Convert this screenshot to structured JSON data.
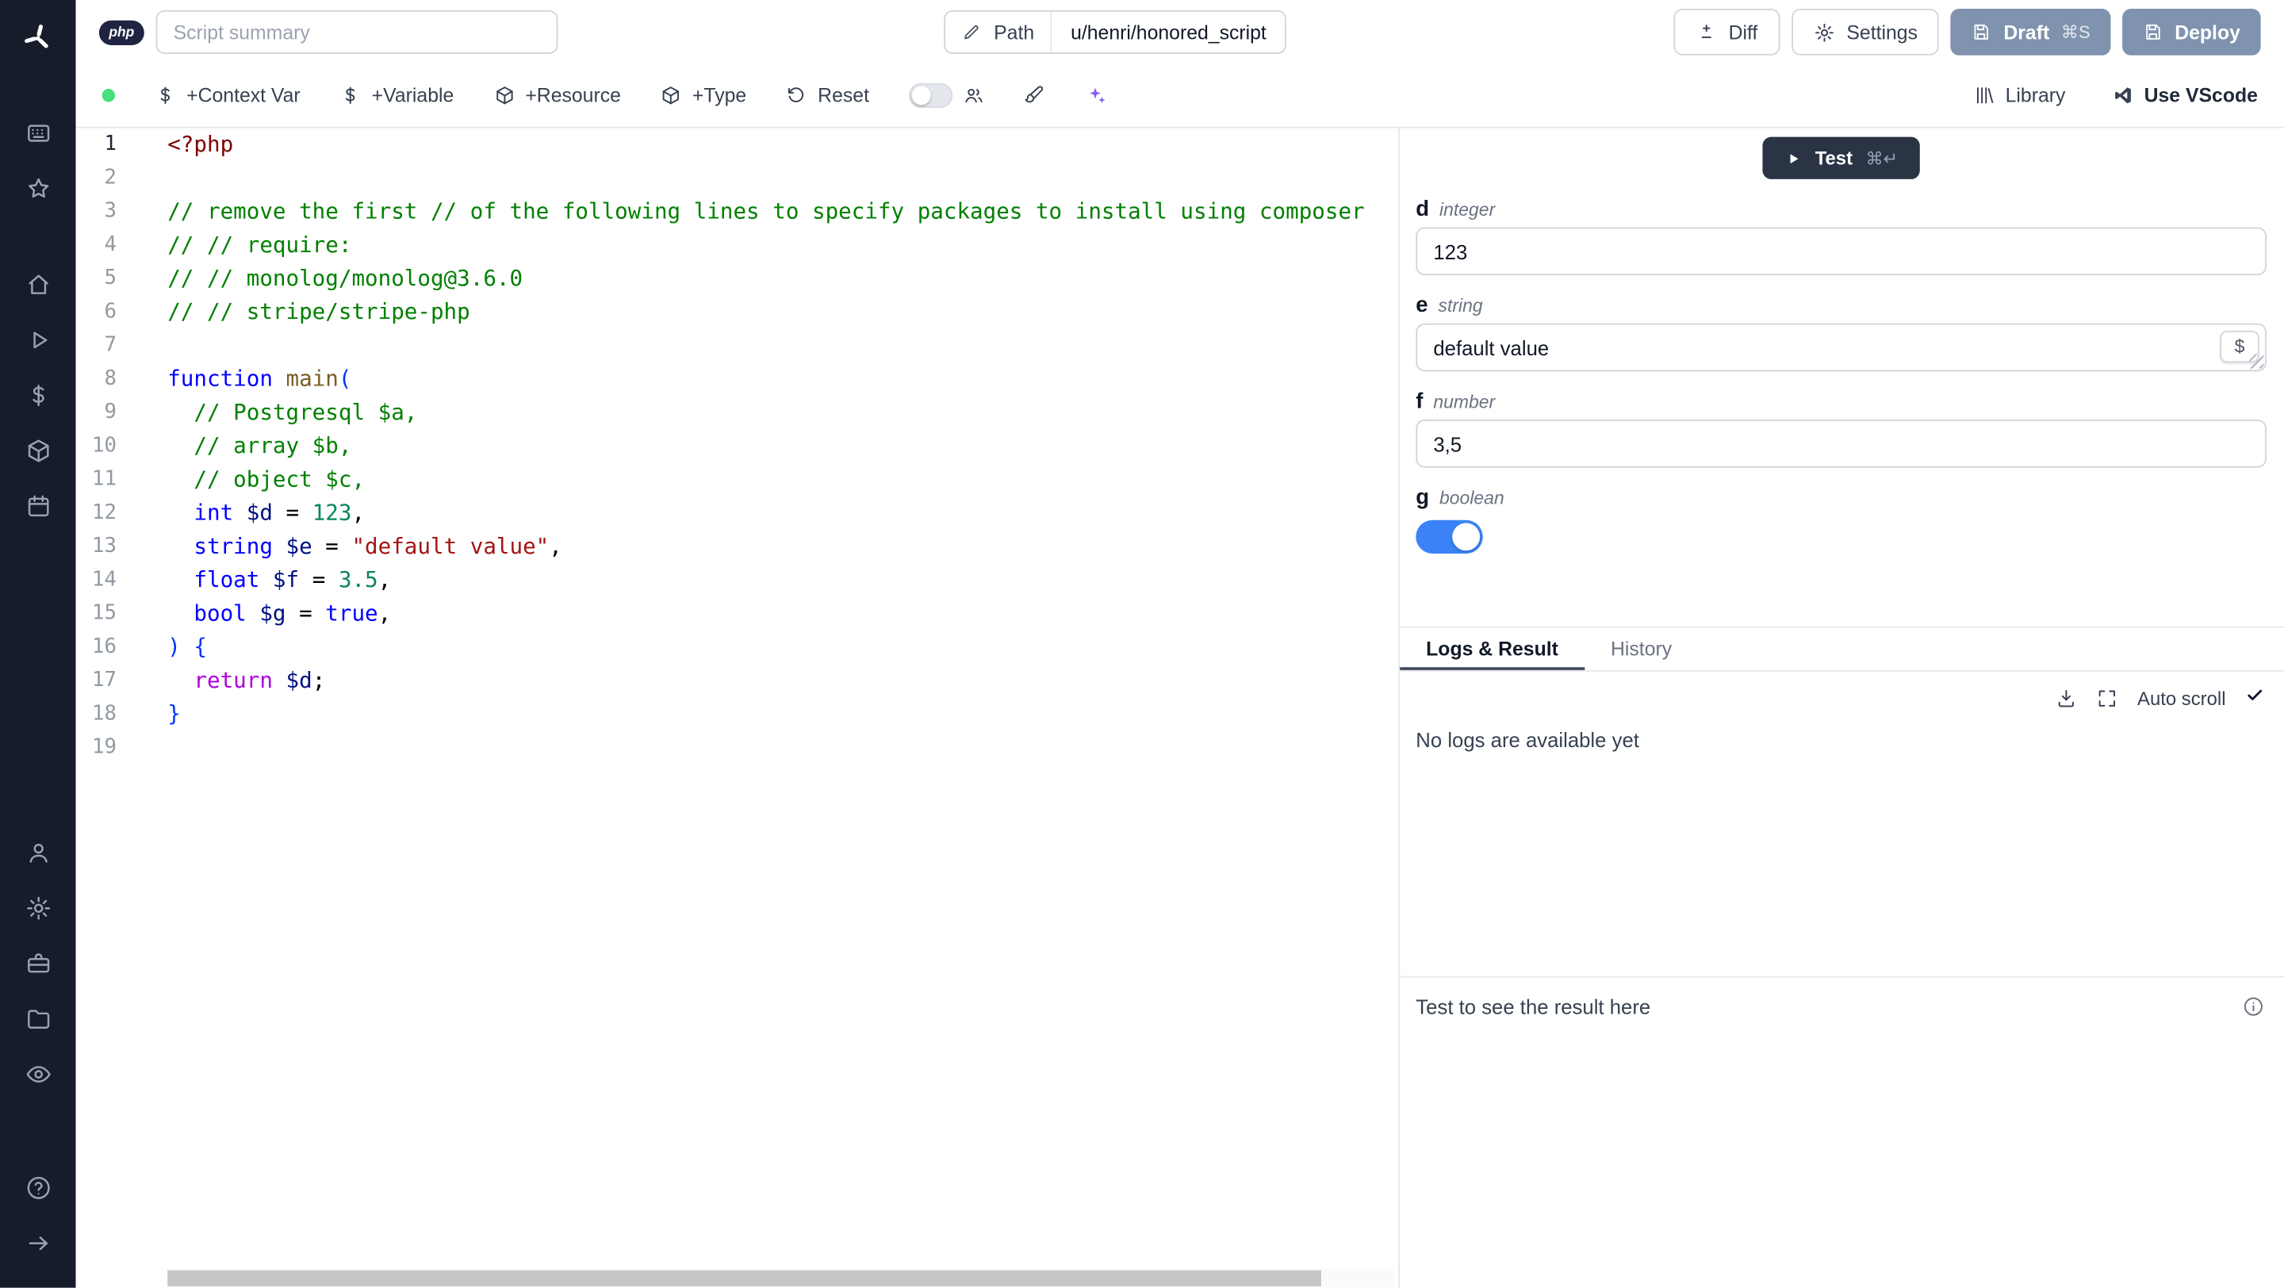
{
  "header": {
    "language_badge": "php",
    "summary_placeholder": "Script summary",
    "path": {
      "label": "Path",
      "value": "u/henri/honored_script"
    },
    "buttons": {
      "diff": "Diff",
      "settings": "Settings",
      "draft": "Draft",
      "draft_shortcut": "⌘S",
      "deploy": "Deploy"
    }
  },
  "toolbar": {
    "status_color": "#4ade80",
    "add_context_var": "+Context Var",
    "add_variable": "+Variable",
    "add_resource": "+Resource",
    "add_type": "+Type",
    "reset": "Reset",
    "library": "Library",
    "use_vscode": "Use VScode",
    "ai_icon_color": "#8b5cf6"
  },
  "sidebar": {
    "icons": [
      "windmill-logo",
      "workspace",
      "favorites",
      "home",
      "runs",
      "variables",
      "resources",
      "schedules",
      "user",
      "settings",
      "workers",
      "folders",
      "audit",
      "help",
      "collapse"
    ]
  },
  "editor": {
    "language": "php",
    "active_line": 1,
    "lines": [
      [
        [
          "<?php",
          "m"
        ]
      ],
      [],
      [
        [
          "// remove the first // of the following lines to specify packages to install using composer",
          "c"
        ]
      ],
      [
        [
          "// // require:",
          "c"
        ]
      ],
      [
        [
          "// // monolog/monolog@3.6.0",
          "c"
        ]
      ],
      [
        [
          "// // stripe/stripe-php",
          "c"
        ]
      ],
      [],
      [
        [
          "function",
          "k"
        ],
        [
          " ",
          "p"
        ],
        [
          "main",
          "f"
        ],
        [
          "(",
          "b"
        ]
      ],
      [
        [
          "  ",
          "p"
        ],
        [
          "// Postgresql $a,",
          "c"
        ]
      ],
      [
        [
          "  ",
          "p"
        ],
        [
          "// array $b,",
          "c"
        ]
      ],
      [
        [
          "  ",
          "p"
        ],
        [
          "// object $c,",
          "c"
        ]
      ],
      [
        [
          "  ",
          "p"
        ],
        [
          "int",
          "k"
        ],
        [
          " ",
          "p"
        ],
        [
          "$d",
          "v"
        ],
        [
          " = ",
          "p"
        ],
        [
          "123",
          "n"
        ],
        [
          ",",
          "p"
        ]
      ],
      [
        [
          "  ",
          "p"
        ],
        [
          "string",
          "k"
        ],
        [
          " ",
          "p"
        ],
        [
          "$e",
          "v"
        ],
        [
          " = ",
          "p"
        ],
        [
          "\"default value\"",
          "s"
        ],
        [
          ",",
          "p"
        ]
      ],
      [
        [
          "  ",
          "p"
        ],
        [
          "float",
          "k"
        ],
        [
          " ",
          "p"
        ],
        [
          "$f",
          "v"
        ],
        [
          " = ",
          "p"
        ],
        [
          "3.5",
          "n"
        ],
        [
          ",",
          "p"
        ]
      ],
      [
        [
          "  ",
          "p"
        ],
        [
          "bool",
          "k"
        ],
        [
          " ",
          "p"
        ],
        [
          "$g",
          "v"
        ],
        [
          " = ",
          "p"
        ],
        [
          "true",
          "k"
        ],
        [
          ",",
          "p"
        ]
      ],
      [
        [
          ") {",
          "b"
        ]
      ],
      [
        [
          "  ",
          "p"
        ],
        [
          "return",
          "r"
        ],
        [
          " ",
          "p"
        ],
        [
          "$d",
          "v"
        ],
        [
          ";",
          "p"
        ]
      ],
      [
        [
          "}",
          "b"
        ]
      ],
      []
    ]
  },
  "test_panel": {
    "test_button": {
      "label": "Test",
      "shortcut": "⌘↵"
    },
    "fields": [
      {
        "name": "d",
        "type": "integer",
        "value": "123",
        "control": "input"
      },
      {
        "name": "e",
        "type": "string",
        "value": "default value",
        "control": "input_with_var"
      },
      {
        "name": "f",
        "type": "number",
        "value": "3,5",
        "control": "input"
      },
      {
        "name": "g",
        "type": "boolean",
        "value": true,
        "control": "toggle"
      }
    ],
    "var_button_label": "$",
    "tabs": {
      "items": [
        "Logs & Result",
        "History"
      ],
      "active": "Logs & Result"
    },
    "auto_scroll_label": "Auto scroll",
    "empty_logs_text": "No logs are available yet",
    "result_placeholder": "Test to see the result here",
    "accent_color": "#3b82f6"
  }
}
